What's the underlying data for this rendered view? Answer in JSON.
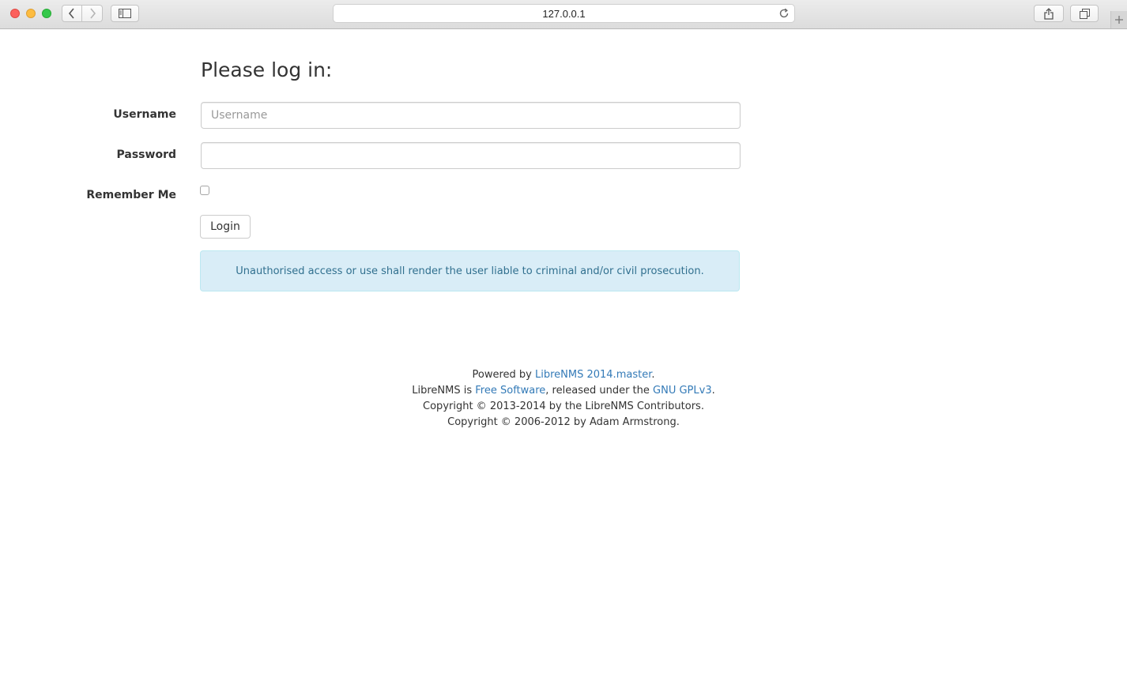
{
  "browser": {
    "url": "127.0.0.1"
  },
  "login": {
    "title": "Please log in:",
    "username_label": "Username",
    "username_placeholder": "Username",
    "username_value": "",
    "password_label": "Password",
    "password_value": "",
    "remember_label": "Remember Me",
    "remember_checked": false,
    "login_button": "Login",
    "notice": "Unauthorised access or use shall render the user liable to criminal and/or civil prosecution."
  },
  "footer": {
    "line1_prefix": "Powered by ",
    "line1_link": "LibreNMS 2014.master",
    "line1_suffix": ".",
    "line2_prefix": "LibreNMS is ",
    "line2_link1": "Free Software",
    "line2_middle": ", released under the ",
    "line2_link2": "GNU GPLv3",
    "line2_suffix": ".",
    "line3": "Copyright © 2013-2014 by the LibreNMS Contributors.",
    "line4": "Copyright © 2006-2012 by Adam Armstrong."
  },
  "colors": {
    "link": "#337ab7",
    "alert_bg": "#d9edf7",
    "alert_text": "#31708f"
  }
}
